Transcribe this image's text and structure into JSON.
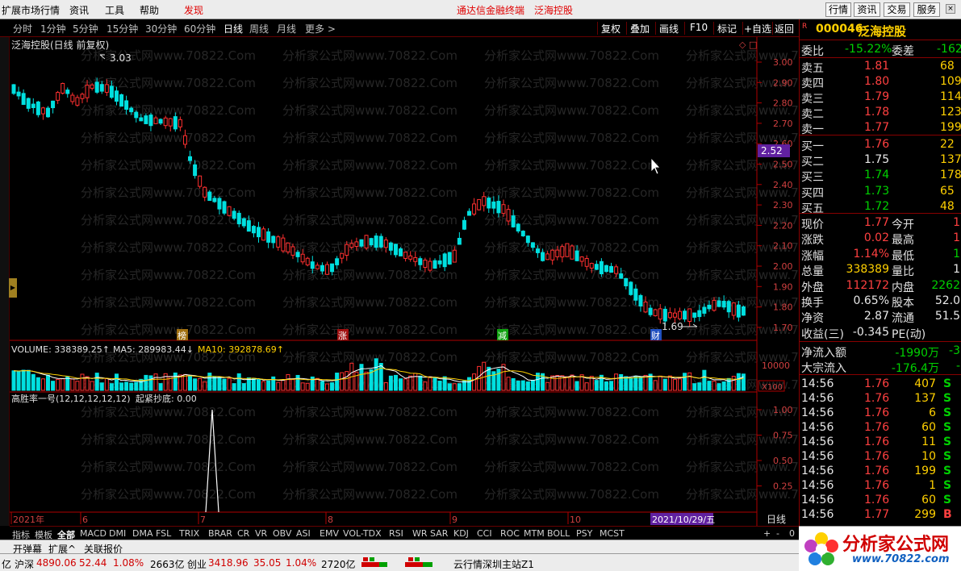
{
  "menubar": {
    "items": [
      "扩展市场行情",
      "资讯",
      "工具",
      "帮助",
      "发现"
    ],
    "center_links": [
      "通达信金融终端",
      "泛海控股"
    ],
    "right_buttons": [
      "行情",
      "资讯",
      "交易",
      "服务"
    ],
    "close_glyph": "×"
  },
  "toolbar": {
    "timeframes": [
      "分时",
      "1分钟",
      "5分钟",
      "15分钟",
      "30分钟",
      "60分钟",
      "日线",
      "周线",
      "月线",
      "更多 >"
    ],
    "actions": [
      "复权",
      "叠加",
      "画线",
      "F10",
      "标记",
      "+自选",
      "返回"
    ]
  },
  "chart": {
    "title": "泛海控股(日线 前复权)",
    "price_axis": [
      "3.00",
      "2.90",
      "2.80",
      "2.70",
      "2.60",
      "2.50",
      "2.40",
      "2.30",
      "2.20",
      "2.10",
      "2.00",
      "1.90",
      "1.80",
      "1.70"
    ],
    "current_marker": "2.52",
    "high_label": "3.03",
    "low_label": "1.69",
    "watermark": "分析家公式网www.70822.Com",
    "badges": [
      {
        "text": "榜",
        "bg": "#a07010",
        "color": "#ffffff"
      },
      {
        "text": "涨",
        "bg": "#a01010",
        "color": "#ffffff"
      },
      {
        "text": "减",
        "bg": "#10a010",
        "color": "#ffffff"
      },
      {
        "text": "财",
        "bg": "#2050c0",
        "color": "#ffffff"
      }
    ],
    "volume": {
      "label": "VOLUME: 338389.25↑",
      "ma5": "MA5: 289983.44↓",
      "ma10": "MA10: 392878.69↑",
      "axis": [
        "10000"
      ],
      "unit": "X100"
    },
    "indicator": {
      "title": "高胜率一号(12,12,12,12,12)",
      "signal": "起紧抄底: 0.00",
      "axis": [
        "1.00",
        "0.75",
        "0.50",
        "0.25"
      ]
    },
    "date_axis": [
      "2021年",
      "6",
      "7",
      "8",
      "9",
      "10"
    ],
    "date_cursor": "2021/10/29/五",
    "period_label": "日线",
    "colors": {
      "up": "#ff3030",
      "down": "#00e0e0",
      "ma5": "#ffffff",
      "ma10": "#ffd000",
      "axis": "#b00000"
    }
  },
  "quotes": {
    "code": "000046",
    "name": "泛海控股",
    "ratio_label": "委比",
    "ratio": "-15.22%",
    "diff_label": "委差",
    "diff": "-162",
    "asks": [
      {
        "label": "卖五",
        "price": "1.81",
        "vol": "68"
      },
      {
        "label": "卖四",
        "price": "1.80",
        "vol": "109"
      },
      {
        "label": "卖三",
        "price": "1.79",
        "vol": "114"
      },
      {
        "label": "卖二",
        "price": "1.78",
        "vol": "123"
      },
      {
        "label": "卖一",
        "price": "1.77",
        "vol": "199"
      }
    ],
    "bids": [
      {
        "label": "买一",
        "price": "1.76",
        "vol": "22"
      },
      {
        "label": "买二",
        "price": "1.75",
        "vol": "137"
      },
      {
        "label": "买三",
        "price": "1.74",
        "vol": "178"
      },
      {
        "label": "买四",
        "price": "1.73",
        "vol": "65"
      },
      {
        "label": "买五",
        "price": "1.72",
        "vol": "48"
      }
    ],
    "stats": [
      {
        "l1": "现价",
        "v1": "1.77",
        "c1": "up",
        "l2": "今开",
        "v2": "1",
        "c2": "up"
      },
      {
        "l1": "涨跌",
        "v1": "0.02",
        "c1": "up",
        "l2": "最高",
        "v2": "1",
        "c2": "up"
      },
      {
        "l1": "涨幅",
        "v1": "1.14%",
        "c1": "up",
        "l2": "最低",
        "v2": "1",
        "c2": "dn"
      },
      {
        "l1": "总量",
        "v1": "338389",
        "c1": "yl",
        "l2": "量比",
        "v2": "1",
        "c2": "wh"
      },
      {
        "l1": "外盘",
        "v1": "112172",
        "c1": "up",
        "l2": "内盘",
        "v2": "2262",
        "c2": "dn"
      },
      {
        "l1": "换手",
        "v1": "0.65%",
        "c1": "wh",
        "l2": "股本",
        "v2": "52.0",
        "c2": "wh"
      },
      {
        "l1": "净资",
        "v1": "2.87",
        "c1": "wh",
        "l2": "流通",
        "v2": "51.5",
        "c2": "wh"
      },
      {
        "l1": "收益(三)",
        "v1": "-0.345",
        "c1": "wh",
        "l2": "PE(动)",
        "v2": "",
        "c2": "wh"
      }
    ],
    "flows": [
      {
        "label": "净流入额",
        "value": "-1990万",
        "extra": "-3"
      },
      {
        "label": "大宗流入",
        "value": "-176.4万",
        "extra": "-"
      }
    ],
    "ticks": [
      {
        "time": "14:56",
        "price": "1.76",
        "vol": "407",
        "side": "S"
      },
      {
        "time": "14:56",
        "price": "1.76",
        "vol": "137",
        "side": "S"
      },
      {
        "time": "14:56",
        "price": "1.76",
        "vol": "6",
        "side": "S"
      },
      {
        "time": "14:56",
        "price": "1.76",
        "vol": "60",
        "side": "S"
      },
      {
        "time": "14:56",
        "price": "1.76",
        "vol": "11",
        "side": "S"
      },
      {
        "time": "14:56",
        "price": "1.76",
        "vol": "10",
        "side": "S"
      },
      {
        "time": "14:56",
        "price": "1.76",
        "vol": "199",
        "side": "S"
      },
      {
        "time": "14:56",
        "price": "1.76",
        "vol": "1",
        "side": "S"
      },
      {
        "time": "14:56",
        "price": "1.76",
        "vol": "60",
        "side": "S"
      },
      {
        "time": "14:56",
        "price": "1.77",
        "vol": "299",
        "side": "B"
      }
    ]
  },
  "bottom_tabs": [
    "指标",
    "模板",
    "全部",
    "MACD",
    "DMI",
    "DMA",
    "FSL",
    "TRIX",
    "BRAR",
    "CR",
    "VR",
    "OBV",
    "ASI",
    "EMV",
    "VOL-TDX",
    "RSI",
    "WR",
    "SAR",
    "KDJ",
    "CCI",
    "ROC",
    "MTM",
    "BOLL",
    "PSY",
    "MCST"
  ],
  "bottom_controls": [
    "+",
    "-",
    "0"
  ],
  "status_row": [
    "开弹幕",
    "扩展^",
    "关联报价"
  ],
  "status_bar": {
    "prefix": "亿",
    "index1_name": "沪深",
    "index1_value": "4890.06",
    "index1_change": "52.44",
    "index1_pct": "1.08%",
    "amount1": "2663亿",
    "index2_name": "创业",
    "index2_value": "3418.96",
    "index2_change": "35.05",
    "index2_pct": "1.04%",
    "amount2": "2720亿",
    "server": "云行情深圳主站Z1"
  },
  "brand": {
    "name": "分析家公式网",
    "url": "www.70822.com"
  }
}
